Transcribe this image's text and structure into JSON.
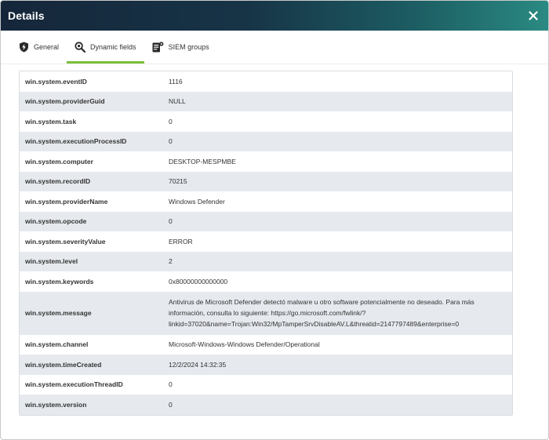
{
  "dialog": {
    "title": "Details"
  },
  "tabs": [
    {
      "label": "General",
      "icon": "shield-bolt-icon",
      "active": false
    },
    {
      "label": "Dynamic fields",
      "icon": "magnifier-icon",
      "active": true
    },
    {
      "label": "SIEM groups",
      "icon": "document-gear-icon",
      "active": false
    }
  ],
  "rows": [
    {
      "key": "win.system.eventID",
      "value": "1116"
    },
    {
      "key": "win.system.providerGuid",
      "value": "NULL"
    },
    {
      "key": "win.system.task",
      "value": "0"
    },
    {
      "key": "win.system.executionProcessID",
      "value": "0"
    },
    {
      "key": "win.system.computer",
      "value": "DESKTOP-MESPMBE"
    },
    {
      "key": "win.system.recordID",
      "value": "70215"
    },
    {
      "key": "win.system.providerName",
      "value": "Windows Defender"
    },
    {
      "key": "win.system.opcode",
      "value": "0"
    },
    {
      "key": "win.system.severityValue",
      "value": "ERROR"
    },
    {
      "key": "win.system.level",
      "value": "2"
    },
    {
      "key": "win.system.keywords",
      "value": "0x80000000000000"
    },
    {
      "key": "win.system.message",
      "value": "Antivirus de Microsoft Defender detectó malware u otro software potencialmente no deseado. Para más información, consulta lo siguiente: https://go.microsoft.com/fwlink/?linkid=37020&name=Trojan:Win32/MpTamperSrvDisableAV.L&threatid=2147797489&enterprise=0"
    },
    {
      "key": "win.system.channel",
      "value": "Microsoft-Windows-Windows Defender/Operational"
    },
    {
      "key": "win.system.timeCreated",
      "value": "12/2/2024 14:32:35"
    },
    {
      "key": "win.system.executionThreadID",
      "value": "0"
    },
    {
      "key": "win.system.version",
      "value": "0"
    }
  ],
  "colors": {
    "accent": "#7bbf3a",
    "header_start": "#15263a",
    "header_end": "#2a8a82",
    "row_alt": "#e6e9ee"
  }
}
